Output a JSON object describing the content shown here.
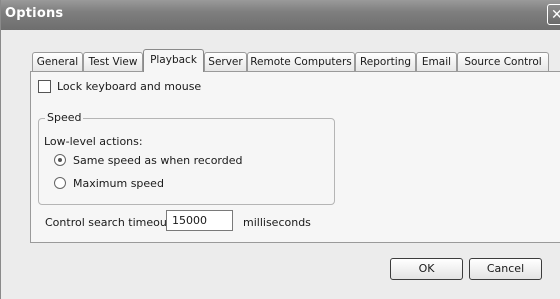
{
  "window": {
    "title": "Options",
    "close_symbol": "✕"
  },
  "tabs": [
    {
      "label": "General"
    },
    {
      "label": "Test View"
    },
    {
      "label": "Playback"
    },
    {
      "label": "Server"
    },
    {
      "label": "Remote Computers"
    },
    {
      "label": "Reporting"
    },
    {
      "label": "Email"
    },
    {
      "label": "Source Control"
    }
  ],
  "active_tab": "Playback",
  "playback": {
    "lock_checkbox": {
      "label": "Lock keyboard and mouse",
      "checked": false
    },
    "speed_group": {
      "legend": "Speed",
      "sublabel": "Low-level actions:",
      "options": [
        {
          "label": "Same speed as when recorded",
          "selected": true
        },
        {
          "label": "Maximum speed",
          "selected": false
        }
      ]
    },
    "timeout": {
      "label": "Control search timeout:",
      "value": "15000",
      "unit": "milliseconds"
    }
  },
  "buttons": {
    "ok": "OK",
    "cancel": "Cancel"
  }
}
